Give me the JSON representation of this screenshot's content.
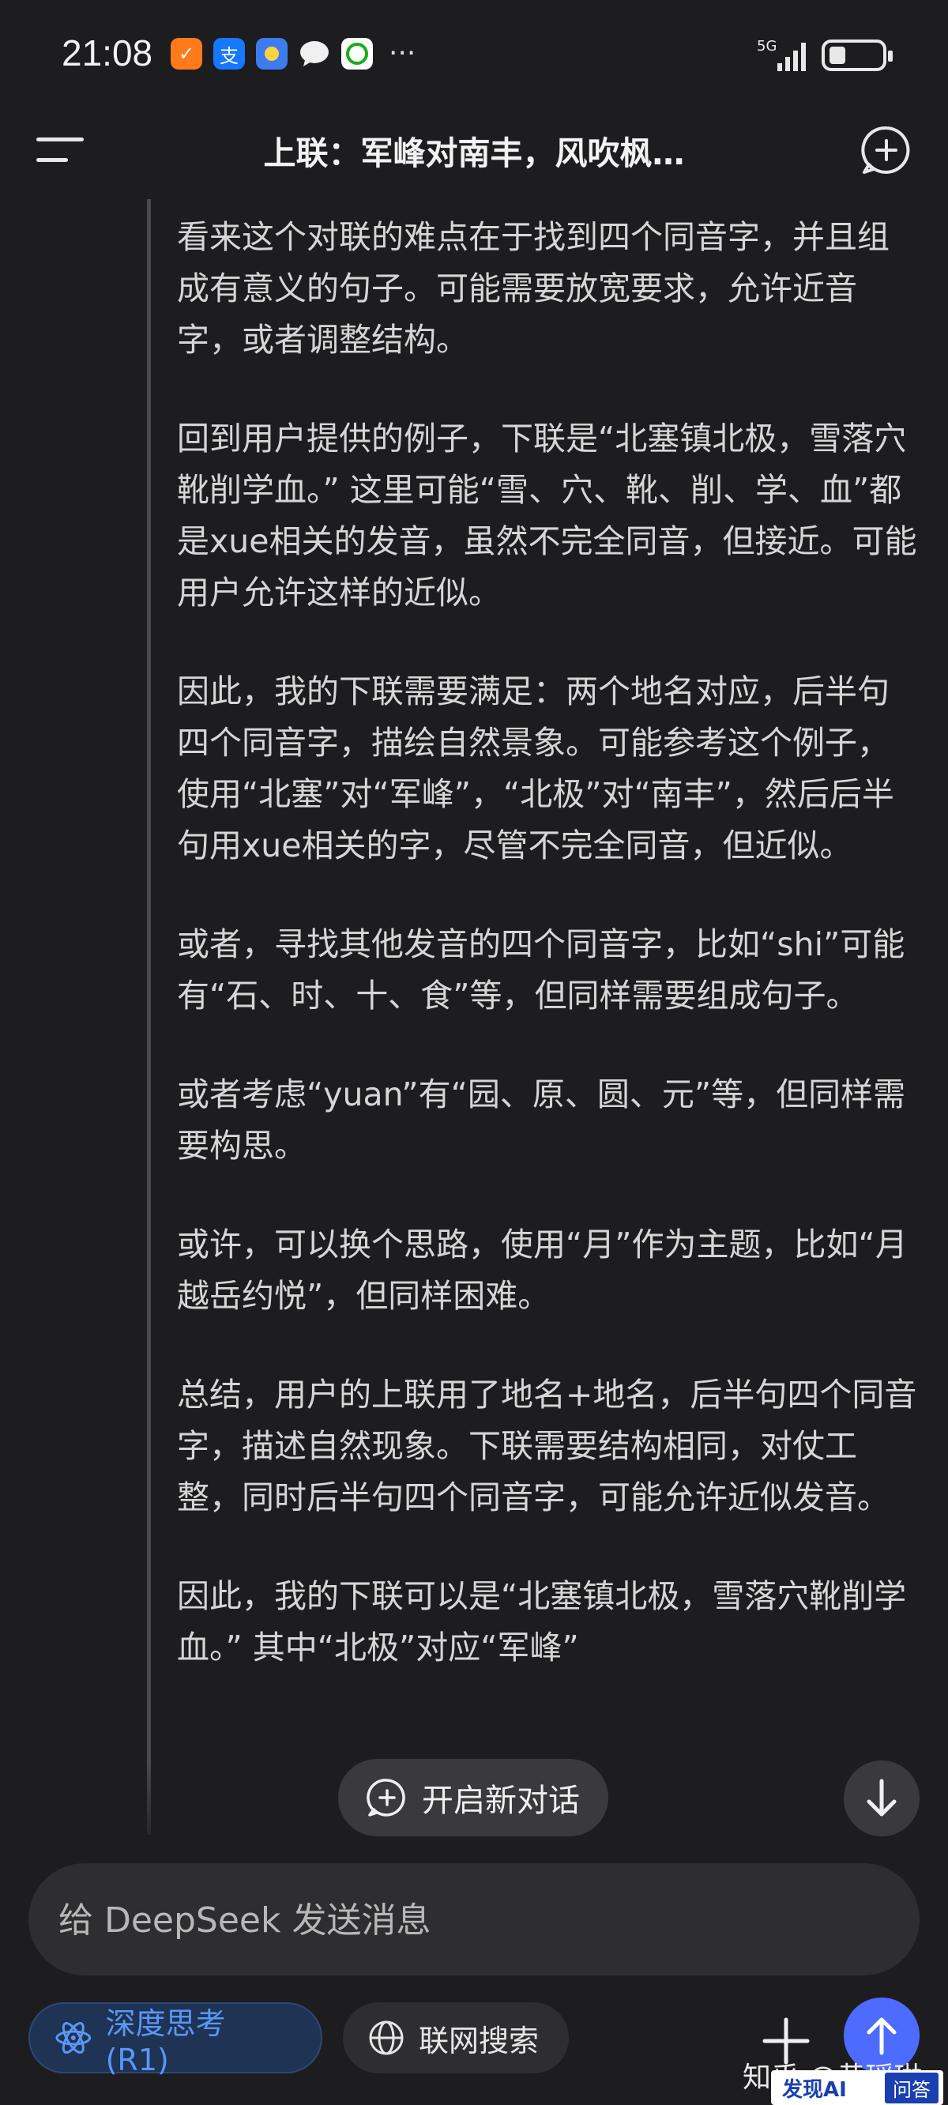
{
  "status_bar": {
    "time": "21:08",
    "network": "5G",
    "app_icons": [
      "taobao-icon",
      "alipay-icon",
      "weather-icon",
      "message-icon",
      "wechat-icon"
    ],
    "more": "···"
  },
  "header": {
    "title": "上联：军峰对南丰，风吹枫…"
  },
  "content": {
    "paragraphs": [
      "看来这个对联的难点在于找到四个同音字，并且组成有意义的句子。可能需要放宽要求，允许近音字，或者调整结构。",
      "回到用户提供的例子，下联是“北塞镇北极，雪落穴靴削学血。” 这里可能“雪、穴、靴、削、学、血”都是xue相关的发音，虽然不完全同音，但接近。可能用户允许这样的近似。",
      "因此，我的下联需要满足：两个地名对应，后半句四个同音字，描绘自然景象。可能参考这个例子，使用“北塞”对“军峰”，“北极”对“南丰”，然后后半句用xue相关的字，尽管不完全同音，但近似。",
      "或者，寻找其他发音的四个同音字，比如“shi”可能有“石、时、十、食”等，但同样需要组成句子。",
      "或者考虑“yuan”有“园、原、圆、元”等，但同样需要构思。",
      "或许，可以换个思路，使用“月”作为主题，比如“月越岳约悦”，但同样困难。",
      "总结，用户的上联用了地名+地名，后半句四个同音字，描述自然现象。下联需要结构相同，对仗工整，同时后半句四个同音字，可能允许近似发音。",
      "因此，我的下联可以是“北塞镇北极，雪落穴靴削学血。” 其中“北极”对应“军峰”"
    ]
  },
  "new_dialog_button": "开启新对话",
  "input": {
    "placeholder": "给 DeepSeek 发送消息"
  },
  "toggles": {
    "deep_think": "深度思考 (R1)",
    "web_search": "联网搜索"
  },
  "watermark": {
    "text": "知乎 @黄瑶琳",
    "badge_brand": "发现AI",
    "badge_tag": "问答"
  },
  "colors": {
    "background": "#1d1d1f",
    "accent": "#4d6bfe",
    "deep_think_text": "#5a97f5"
  }
}
